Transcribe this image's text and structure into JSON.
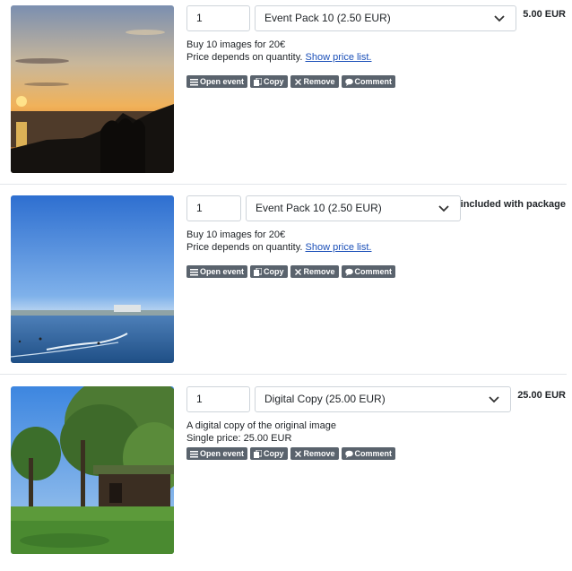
{
  "actions": {
    "open_event": "Open event",
    "copy": "Copy",
    "remove": "Remove",
    "comment": "Comment"
  },
  "items": [
    {
      "image": "sunset-over-sea-photo",
      "quantity": "1",
      "product": "Event Pack 10 (2.50 EUR)",
      "price": "5.00 EUR",
      "desc_line1": "Buy 10 images for 20€",
      "desc_line2": "Price depends on quantity.",
      "price_list_link": "Show price list."
    },
    {
      "image": "beach-bay-photo",
      "quantity": "1",
      "product": "Event Pack 10 (2.50 EUR)",
      "price": "included with package",
      "desc_line1": "Buy 10 images for 20€",
      "desc_line2": "Price depends on quantity.",
      "price_list_link": "Show price list."
    },
    {
      "image": "forest-cabin-photo",
      "quantity": "1",
      "product": "Digital Copy (25.00 EUR)",
      "price": "25.00 EUR",
      "desc_line1": "A digital copy of the original image",
      "desc_line2": "Single price: 25.00 EUR"
    }
  ]
}
